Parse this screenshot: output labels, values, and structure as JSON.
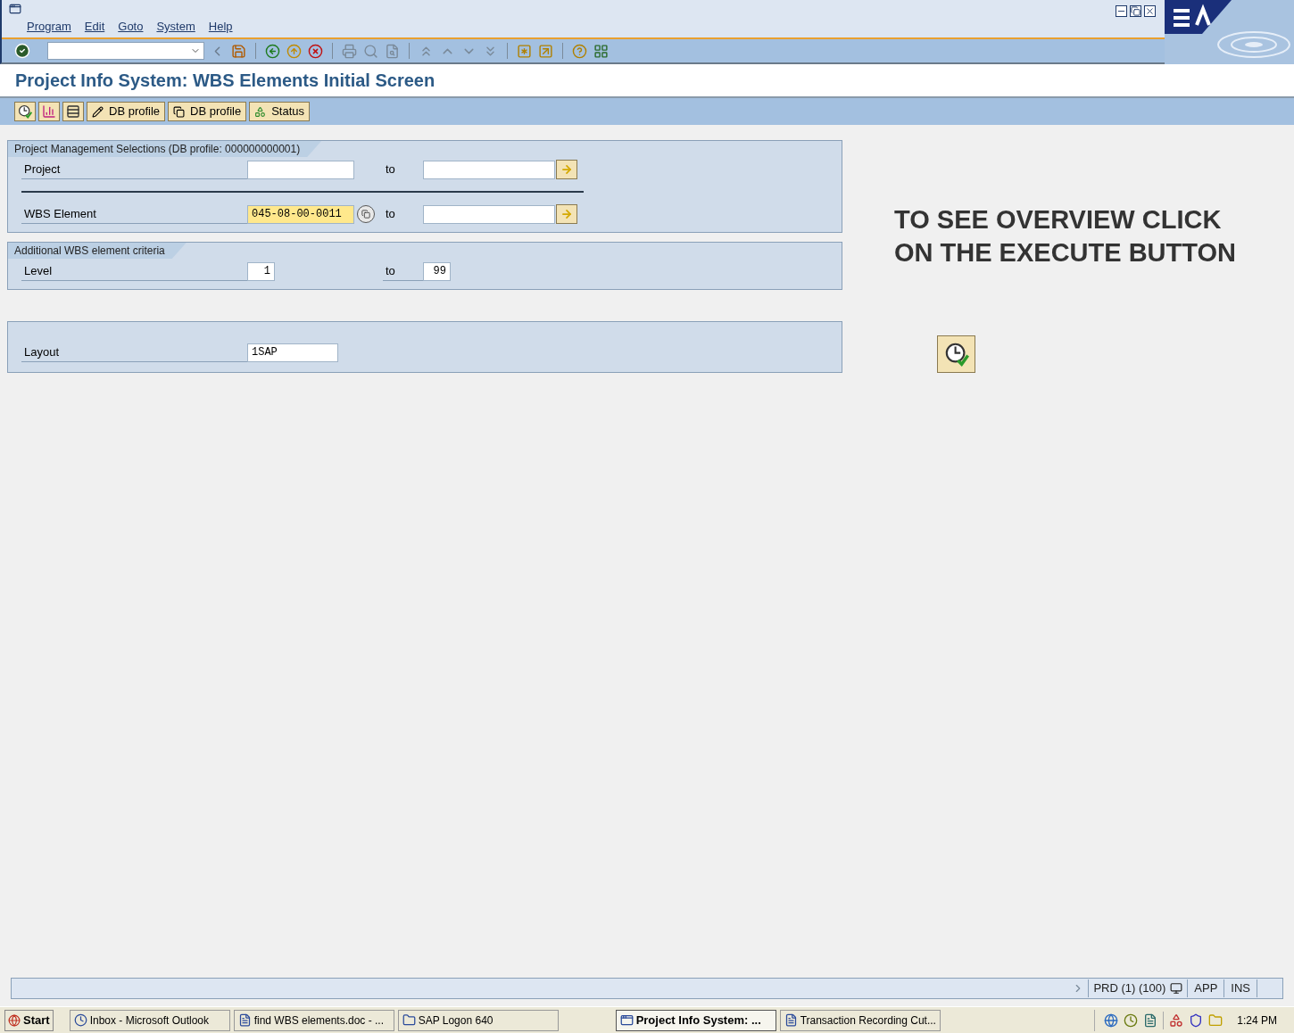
{
  "menu": [
    "Program",
    "Edit",
    "Goto",
    "System",
    "Help"
  ],
  "title": "Project Info System: WBS Elements Initial Screen",
  "app_toolbar": [
    {
      "kind": "icon"
    },
    {
      "kind": "icon"
    },
    {
      "kind": "icon"
    },
    {
      "kind": "text",
      "label": "DB profile"
    },
    {
      "kind": "text",
      "label": "DB profile"
    },
    {
      "kind": "text",
      "label": "Status"
    }
  ],
  "groups": [
    {
      "title": "Project Management Selections (DB profile: 000000000001)",
      "rows": [
        {
          "label": "Project",
          "from": {
            "focused": false
          },
          "to_label": "to",
          "to": {},
          "has_search_help": false
        },
        {
          "label": "WBS Element",
          "from": {
            "value": "045-08-00-0011",
            "focused": true
          },
          "to_label": "to",
          "to": {},
          "has_search_help": true
        }
      ]
    },
    {
      "title": "Additional WBS element criteria",
      "rows": [
        {
          "label": "Level",
          "from": {
            "value": "1",
            "focused": false
          },
          "to_label": "to",
          "to": {
            "value": "99"
          },
          "has_search_help": false
        }
      ]
    },
    {
      "rows": [
        {
          "label": "Layout",
          "from": {
            "value": "1SAP",
            "focused": false
          }
        }
      ]
    }
  ],
  "hint": [
    "TO SEE OVERVIEW CLICK",
    "ON THE EXECUTE BUTTON"
  ],
  "status_bar": {
    "system": "PRD (1) (100)",
    "server": "APP",
    "mode": "INS"
  },
  "taskbar": {
    "start": "Start",
    "tasks": [
      {
        "label": "Inbox - Microsoft Outlook",
        "selected": false
      },
      {
        "label": "find WBS elements.doc - ...",
        "selected": false
      },
      {
        "label": "SAP Logon 640",
        "selected": false
      },
      {
        "label": "Project Info System: ...",
        "selected": true
      },
      {
        "label": "Transaction Recording Cut...",
        "selected": false
      }
    ],
    "clock": "1:24 PM"
  }
}
